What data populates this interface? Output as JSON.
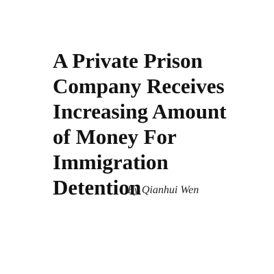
{
  "article": {
    "headline_lines": [
      "A Private Prison",
      "Company Receives",
      "Increasing Amount",
      "of Money For",
      "Immigration",
      "Detention"
    ],
    "byline": "By Qianhui Wen"
  }
}
